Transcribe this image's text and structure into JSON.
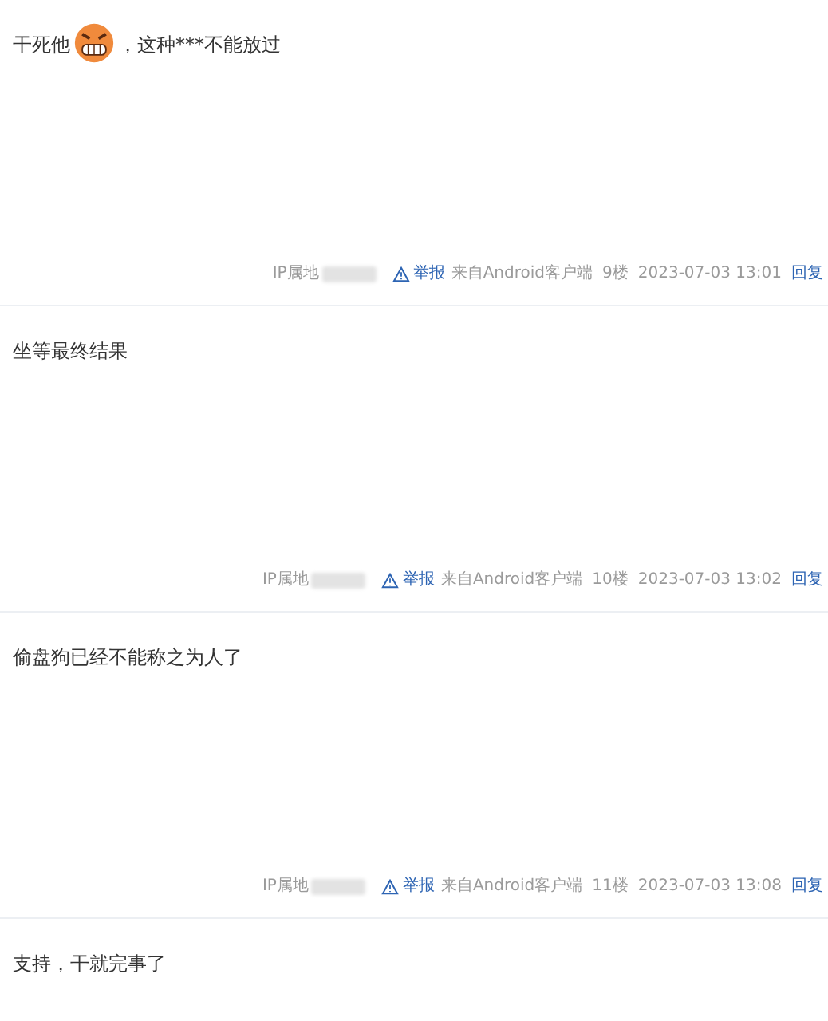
{
  "comments": [
    {
      "content": [
        {
          "kind": "text",
          "text": "干死他"
        },
        {
          "kind": "emoji"
        },
        {
          "kind": "text",
          "text": "，这种***不能放过"
        }
      ],
      "footer": {
        "ip_label": "IP属地",
        "report": "举报",
        "source": "来自Android客户端",
        "floor": "9楼",
        "time": "2023-07-03 13:01",
        "reply": "回复"
      }
    },
    {
      "content": [
        {
          "kind": "text",
          "text": "坐等最终结果"
        }
      ],
      "footer": {
        "ip_label": "IP属地",
        "report": "举报",
        "source": "来自Android客户端",
        "floor": "10楼",
        "time": "2023-07-03 13:02",
        "reply": "回复"
      }
    },
    {
      "content": [
        {
          "kind": "text",
          "text": "偷盘狗已经不能称之为人了"
        }
      ],
      "footer": {
        "ip_label": "IP属地",
        "report": "举报",
        "source": "来自Android客户端",
        "floor": "11楼",
        "time": "2023-07-03 13:08",
        "reply": "回复"
      }
    },
    {
      "content": [
        {
          "kind": "text",
          "text": "支持，干就完事了"
        }
      ]
    }
  ]
}
